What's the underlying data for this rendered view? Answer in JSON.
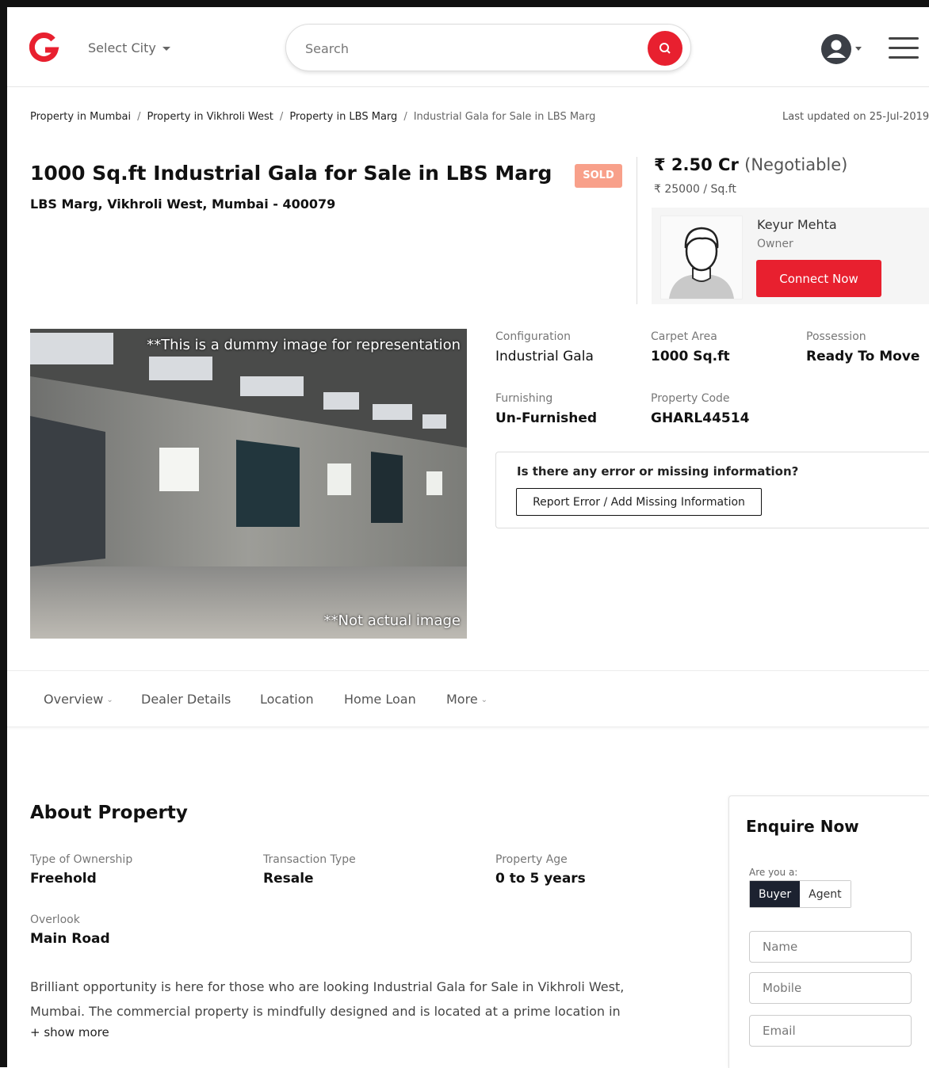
{
  "header": {
    "logo_letter": "G",
    "city_label": "Select City",
    "search_placeholder": "Search"
  },
  "breadcrumb": {
    "items": [
      "Property in Mumbai",
      "Property in Vikhroli West",
      "Property in LBS Marg",
      "Industrial Gala for Sale in LBS Marg"
    ],
    "separator": "/",
    "last_updated": "Last updated on 25-Jul-2019"
  },
  "listing": {
    "title": "1000 Sq.ft Industrial Gala for Sale in LBS Marg",
    "status_badge": "SOLD",
    "address": "LBS Marg, Vikhroli West, Mumbai - 400079",
    "price": "₹ 2.50 Cr",
    "price_note": "(Negotiable)",
    "price_per_sqft": "₹ 25000 / Sq.ft",
    "owner": {
      "name": "Keyur Mehta",
      "role": "Owner",
      "connect_label": "Connect Now"
    },
    "image_caption_top": "**This is a dummy image for representation",
    "image_caption_bottom": "**Not actual image"
  },
  "specs": [
    {
      "label": "Configuration",
      "value": "Industrial Gala"
    },
    {
      "label": "Carpet Area",
      "value": "1000 Sq.ft"
    },
    {
      "label": "Possession",
      "value": "Ready To Move"
    },
    {
      "label": "Furnishing",
      "value": "Un-Furnished"
    },
    {
      "label": "Property Code",
      "value": "GHARL44514"
    }
  ],
  "report": {
    "question": "Is there any error or missing information?",
    "button_label": "Report Error / Add Missing Information"
  },
  "tabs": [
    {
      "label": "Overview"
    },
    {
      "label": "Dealer Details"
    },
    {
      "label": "Location"
    },
    {
      "label": "Home Loan"
    },
    {
      "label": "More"
    }
  ],
  "about": {
    "title": "About Property",
    "items": [
      {
        "label": "Type of Ownership",
        "value": "Freehold"
      },
      {
        "label": "Transaction Type",
        "value": "Resale"
      },
      {
        "label": "Property Age",
        "value": "0 to 5 years"
      },
      {
        "label": "Overlook",
        "value": "Main Road"
      }
    ],
    "description": "Brilliant opportunity is here for those who are looking Industrial Gala for Sale in Vikhroli West, Mumbai. The commercial property is mindfully designed and is located at a prime location in",
    "show_more": "+ show more"
  },
  "enquire": {
    "title": "Enquire Now",
    "are_you": "Are you a:",
    "options": [
      "Buyer",
      "Agent"
    ],
    "name_placeholder": "Name",
    "mobile_placeholder": "Mobile",
    "email_placeholder": "Email"
  },
  "colors": {
    "brand_red": "#e8202f",
    "sold_badge": "#f8a08a",
    "dark_toggle": "#1c2230"
  }
}
